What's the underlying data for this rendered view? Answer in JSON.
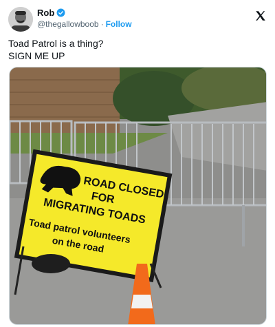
{
  "author": {
    "display_name": "Rob",
    "handle": "@thegallowboob",
    "separator": "·",
    "follow_label": "Follow",
    "verified_icon": "verified-badge-icon"
  },
  "brand_icon": "x-logo-icon",
  "tweet": {
    "line1": "Toad Patrol is a thing?",
    "line2": "SIGN ME UP"
  },
  "photo": {
    "sign_line1": "ROAD CLOSED",
    "sign_line2": "FOR",
    "sign_line3": "MIGRATING TOADS",
    "sign_line4": "Toad patrol volunteers",
    "sign_line5": "on the road"
  },
  "colors": {
    "accent": "#1d9bf0",
    "sign_yellow": "#f5e92a",
    "cone_orange": "#f26a1b"
  }
}
